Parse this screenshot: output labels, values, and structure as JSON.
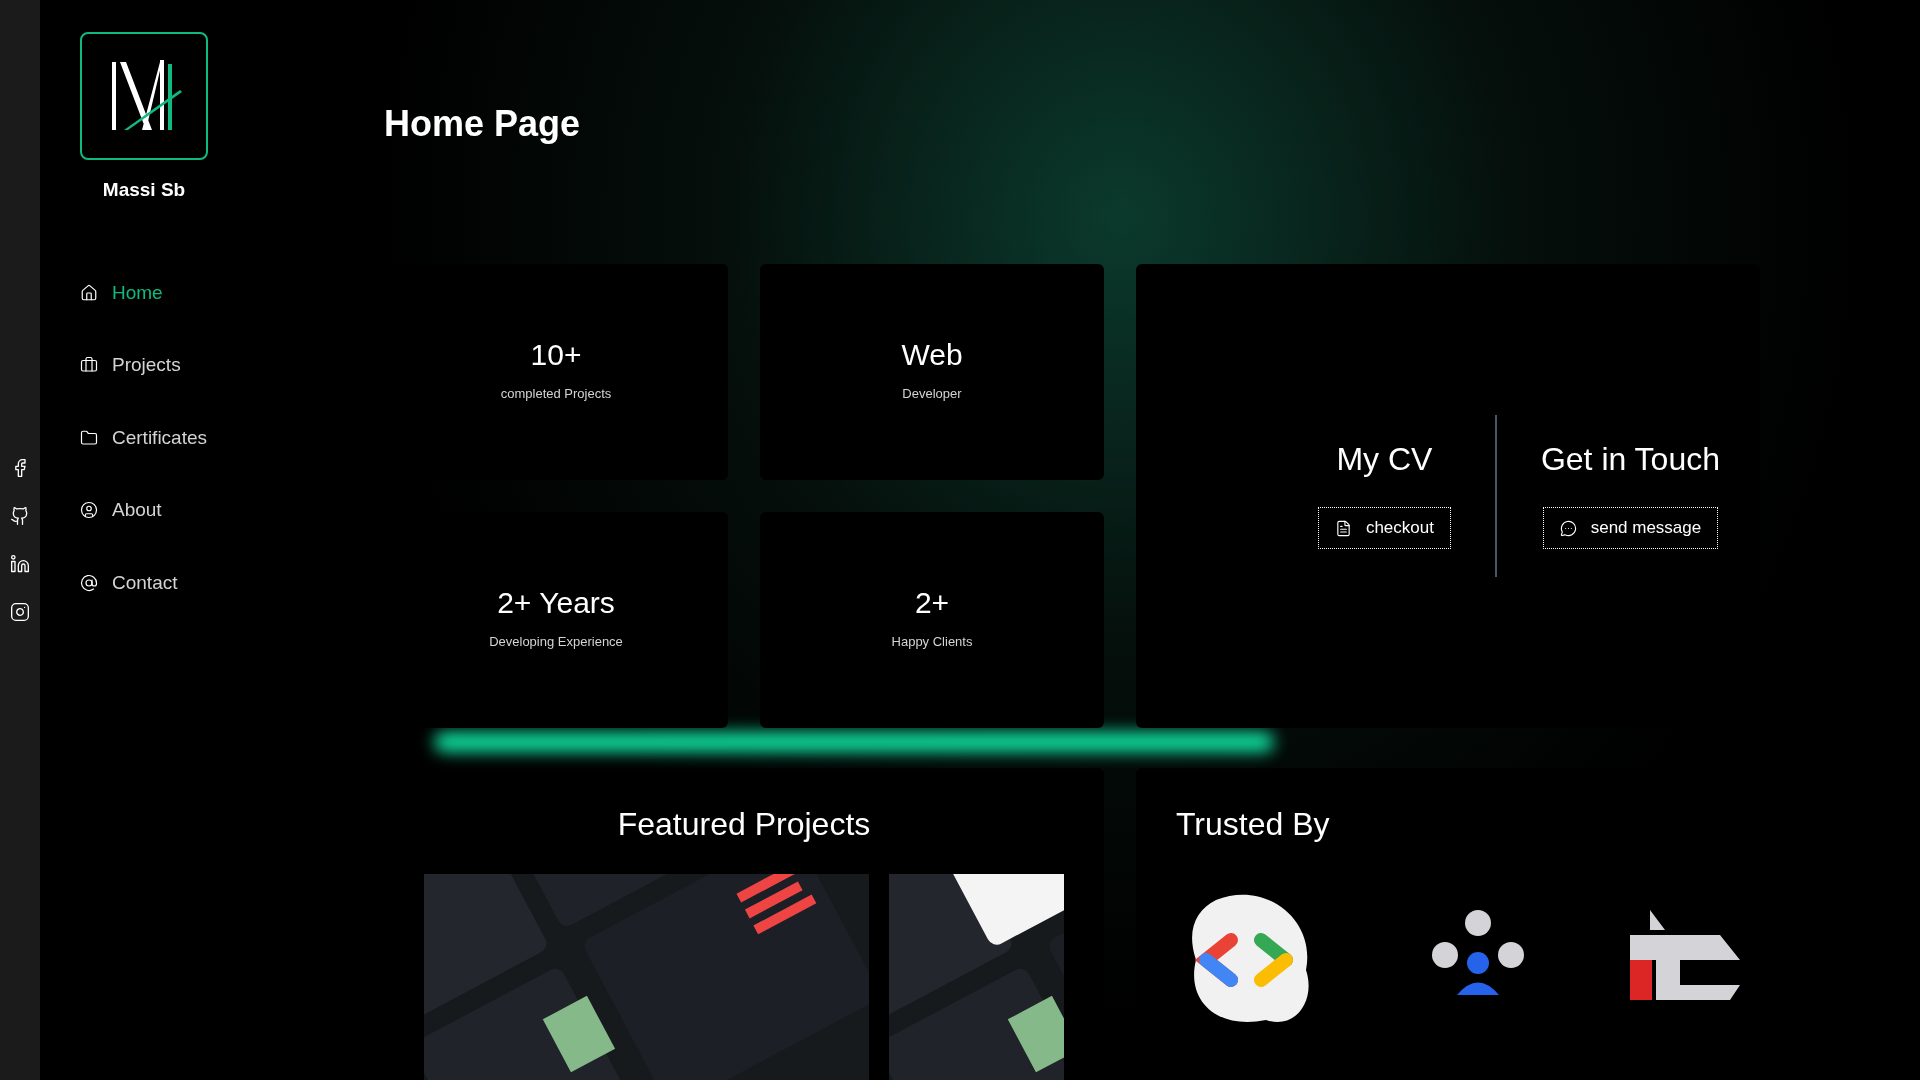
{
  "brand": {
    "name": "Massi Sb"
  },
  "nav": [
    {
      "label": "Home",
      "kind": "home",
      "selected": true
    },
    {
      "label": "Projects",
      "kind": "projects",
      "selected": false
    },
    {
      "label": "Certificates",
      "kind": "certificates",
      "selected": false
    },
    {
      "label": "About",
      "kind": "about",
      "selected": false
    },
    {
      "label": "Contact",
      "kind": "contact",
      "selected": false
    }
  ],
  "social": [
    {
      "kind": "facebook"
    },
    {
      "kind": "github"
    },
    {
      "kind": "linkedin"
    },
    {
      "kind": "instagram"
    }
  ],
  "page": {
    "title": "Home Page"
  },
  "stats": [
    {
      "value": "10+",
      "label": "completed Projects"
    },
    {
      "value": "Web",
      "label": "Developer"
    },
    {
      "value": "2+ Years",
      "label": "Developing Experience"
    },
    {
      "value": "2+",
      "label": "Happy Clients"
    }
  ],
  "actions": [
    {
      "title": "My CV",
      "button": "checkout",
      "kind": "cv"
    },
    {
      "title": "Get in Touch",
      "button": "send message",
      "kind": "message"
    }
  ],
  "featured": {
    "title": "Featured Projects"
  },
  "trusted": {
    "title": "Trusted By"
  }
}
